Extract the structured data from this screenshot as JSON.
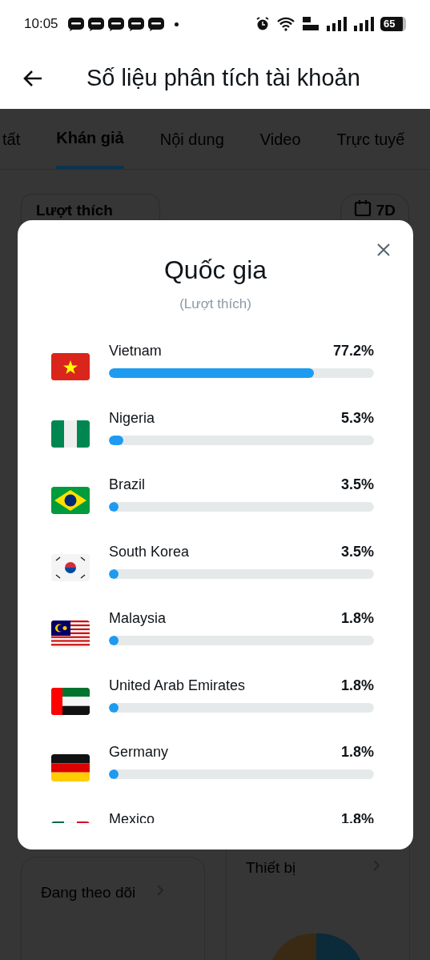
{
  "status_bar": {
    "time": "10:05",
    "notifications": [
      {
        "kind": "zalo"
      },
      {
        "kind": "zalo"
      },
      {
        "kind": "zalo"
      },
      {
        "kind": "zalo"
      },
      {
        "kind": "zalo"
      }
    ],
    "battery": "65"
  },
  "header": {
    "title": "Số liệu phân tích tài khoản"
  },
  "tabs": [
    {
      "label": "tất",
      "selected": false
    },
    {
      "label": "Khán giả",
      "selected": true
    },
    {
      "label": "Nội dung",
      "selected": false
    },
    {
      "label": "Video",
      "selected": false
    },
    {
      "label": "Trực tuyế",
      "selected": false
    }
  ],
  "metric_dropdown": {
    "value": "Lượt thích"
  },
  "range_button": {
    "label": "7D"
  },
  "cards": [
    {
      "title": "Đang theo dõi"
    },
    {
      "title": "Thiết bị"
    }
  ],
  "modal": {
    "title": "Quốc gia",
    "subtitle": "(Lượt thích)",
    "countries": [
      {
        "kind": "vn",
        "name": "Vietnam",
        "value": "77.2%",
        "level": 0.772
      },
      {
        "kind": "ng",
        "name": "Nigeria",
        "value": "5.3%",
        "level": 0.053
      },
      {
        "kind": "br",
        "name": "Brazil",
        "value": "3.5%",
        "level": 0.035
      },
      {
        "kind": "kr",
        "name": "South Korea",
        "value": "3.5%",
        "level": 0.035
      },
      {
        "kind": "my",
        "name": "Malaysia",
        "value": "1.8%",
        "level": 0.018
      },
      {
        "kind": "ae",
        "name": "United Arab Emirates",
        "value": "1.8%",
        "level": 0.018
      },
      {
        "kind": "de",
        "name": "Germany",
        "value": "1.8%",
        "level": 0.018
      },
      {
        "kind": "mx",
        "name": "Mexico",
        "value": "1.8%"
      }
    ]
  }
}
